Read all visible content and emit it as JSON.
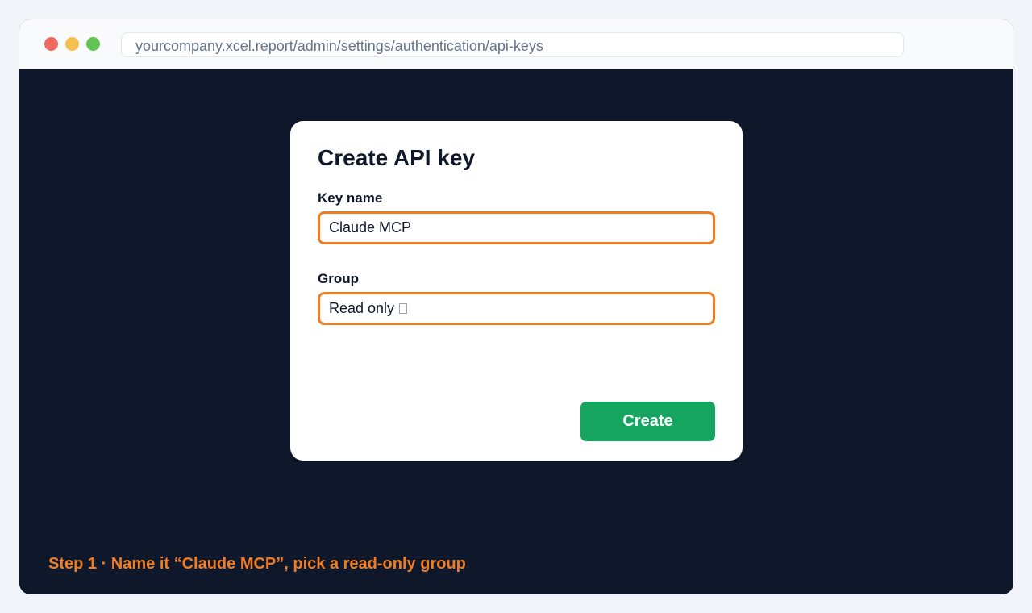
{
  "browser": {
    "url": "yourcompany.xcel.report/admin/settings/authentication/api-keys"
  },
  "dialog": {
    "title": "Create API key",
    "key_name_label": "Key name",
    "key_name_value": "Claude MCP",
    "group_label": "Group",
    "group_value": "Read only",
    "create_label": "Create"
  },
  "caption": "Step 1 · Name it “Claude MCP”, pick a read-only group",
  "colors": {
    "accent": "#ef7d22",
    "create_button": "#16a461",
    "background": "#0f172a"
  }
}
